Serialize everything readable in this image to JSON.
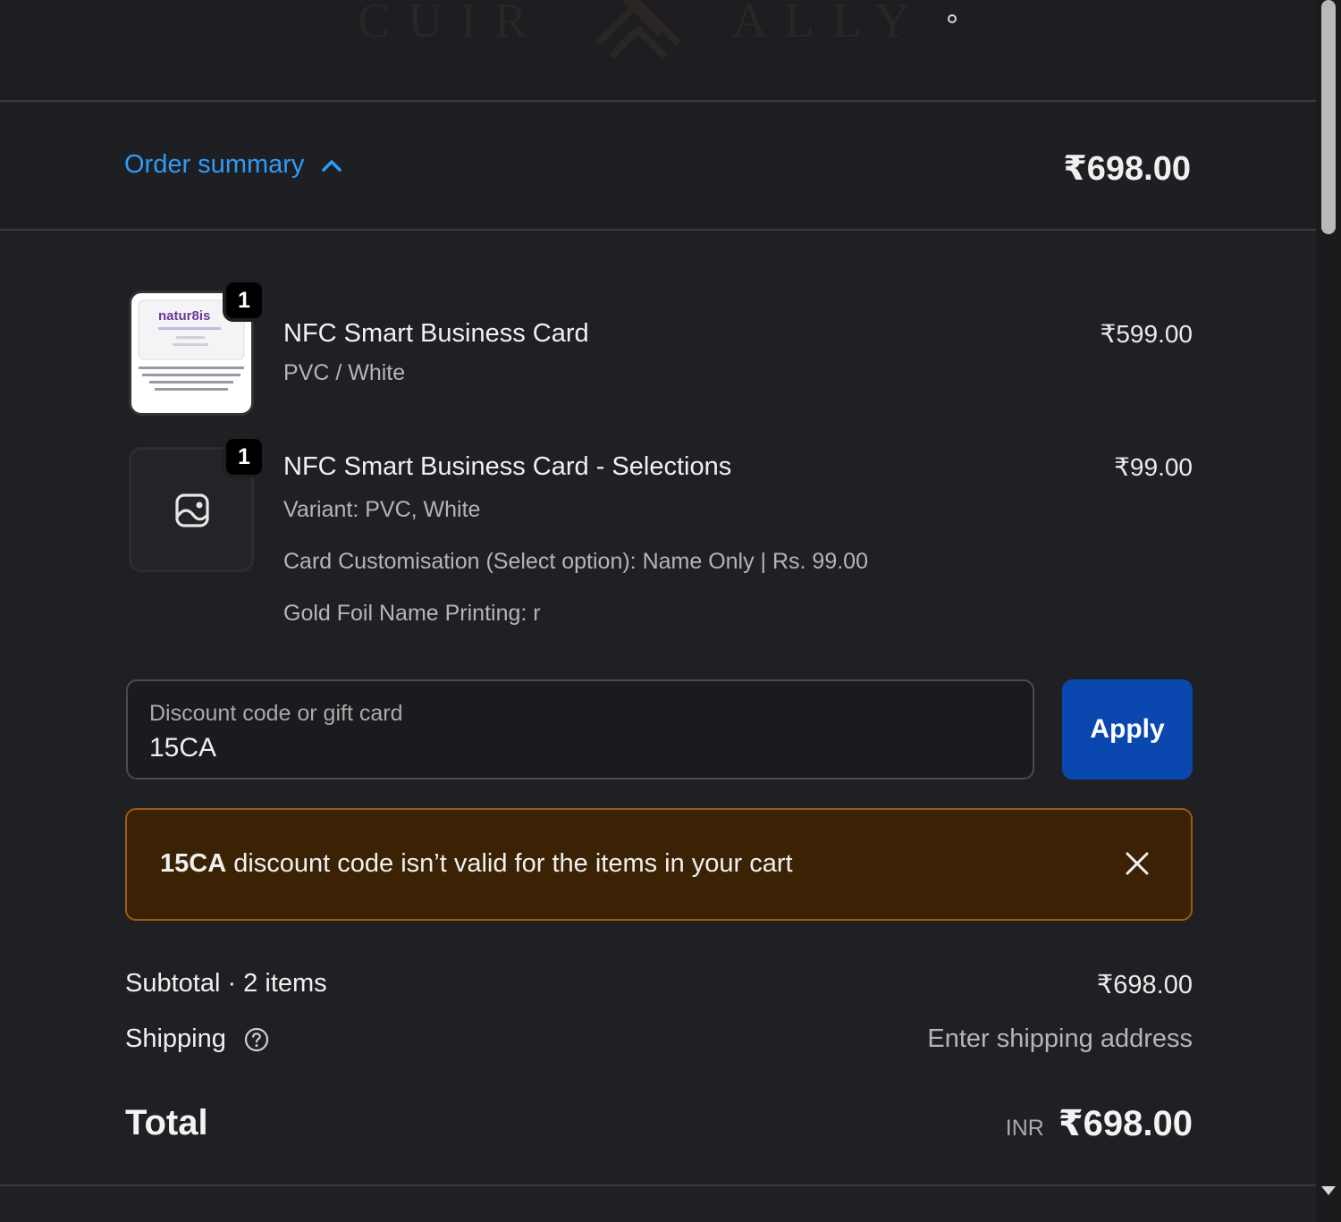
{
  "brand": {
    "logo_text_left": "CUIR",
    "logo_text_right": "ALLY"
  },
  "summary": {
    "toggle_label": "Order summary",
    "total": "₹698.00"
  },
  "items": [
    {
      "title": "NFC Smart Business Card",
      "variant": "PVC / White",
      "price": "₹599.00",
      "quantity": "1",
      "image_text": "natur8is"
    },
    {
      "title": "NFC Smart Business Card - Selections",
      "variant": "Variant: PVC, White",
      "option1": "Card Customisation (Select option): Name Only | Rs. 99.00",
      "option2": "Gold Foil Name Printing: r",
      "price": "₹99.00",
      "quantity": "1",
      "image_icon": "image-placeholder-icon"
    }
  ],
  "discount": {
    "label": "Discount code or gift card",
    "value": "15CA",
    "apply_label": "Apply"
  },
  "alert": {
    "code": "15CA",
    "message": " discount code isn’t valid for the items in your cart"
  },
  "totals": {
    "subtotal_label": "Subtotal · 2 items",
    "subtotal_value": "₹698.00",
    "shipping_label": "Shipping",
    "shipping_value": "Enter shipping address",
    "total_label": "Total",
    "currency": "INR",
    "total_value": "₹698.00"
  },
  "colors": {
    "accent_link": "#2f9bf7",
    "apply_button": "#0a48b0",
    "alert_bg": "#3b2204",
    "alert_border": "#a05a10"
  }
}
